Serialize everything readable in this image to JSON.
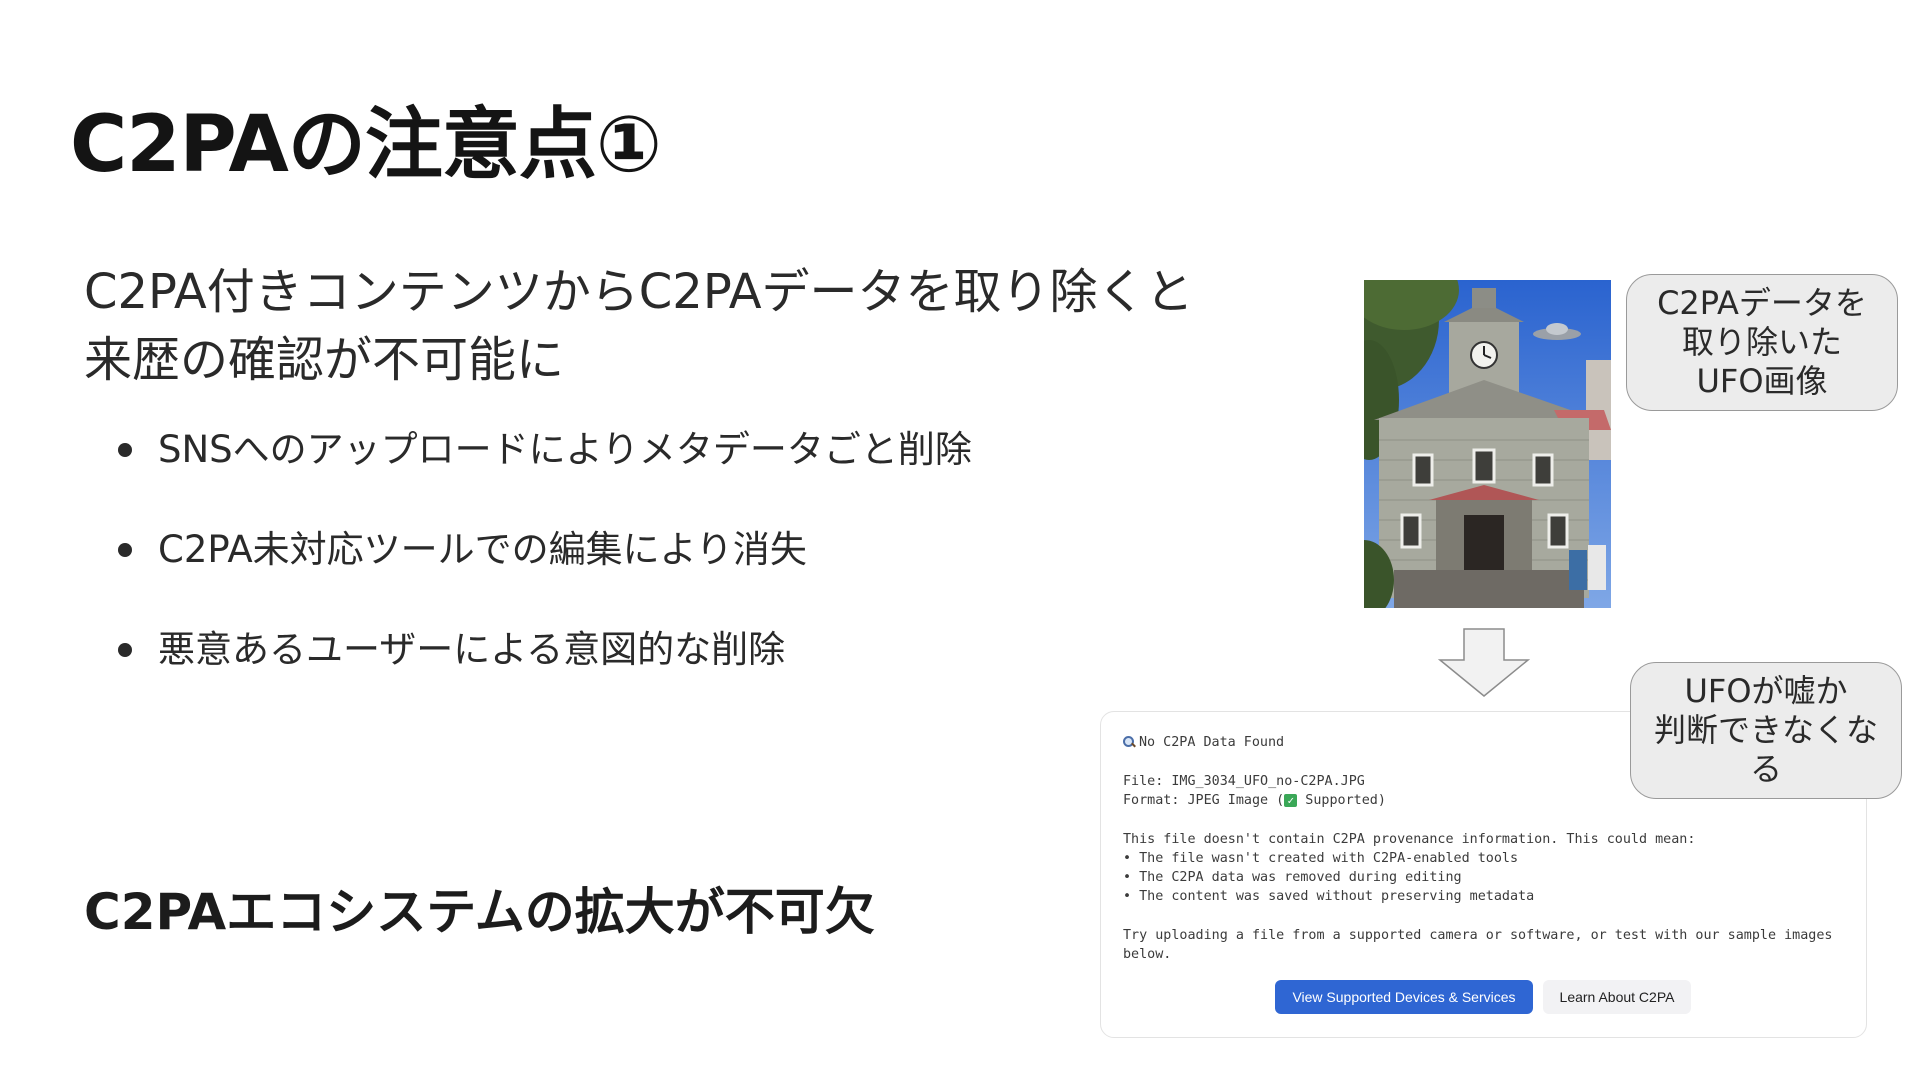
{
  "slide": {
    "title": "C2PAの注意点①",
    "lead_line1": "C2PA付きコンテンツからC2PAデータを取り除くと",
    "lead_line2": "来歴の確認が不可能に",
    "bullets": [
      "SNSへのアップロードによりメタデータごと削除",
      "C2PA未対応ツールでの編集により消失",
      "悪意あるユーザーによる意図的な削除"
    ],
    "conclusion": "C2PAエコシステムの拡大が不可欠"
  },
  "callouts": {
    "top": [
      "C2PAデータを",
      "取り除いた",
      "UFO画像"
    ],
    "bottom": [
      "UFOが嘘か",
      "判断できなくな",
      "る"
    ]
  },
  "panel": {
    "heading_icon": "magnifier-icon",
    "heading": "No C2PA Data Found",
    "file_line": "File: IMG_3034_UFO_no-C2PA.JPG",
    "format_prefix": "Format: JPEG Image (",
    "format_check_icon": "check-icon",
    "format_suffix": " Supported)",
    "intro": "This file doesn't contain C2PA provenance information. This could mean:",
    "reasons": [
      "• The file wasn't created with C2PA-enabled tools",
      "• The C2PA data was removed during editing",
      "• The content was saved without preserving metadata"
    ],
    "try_line1": "Try uploading a file from a supported camera or software, or test with our sample images",
    "try_line2": "below.",
    "primary_button": "View Supported Devices & Services",
    "secondary_button": "Learn About C2PA"
  },
  "colors": {
    "primary_button": "#2f66d3",
    "callout_bg": "#ececec",
    "sky": "#2e6bd6"
  }
}
